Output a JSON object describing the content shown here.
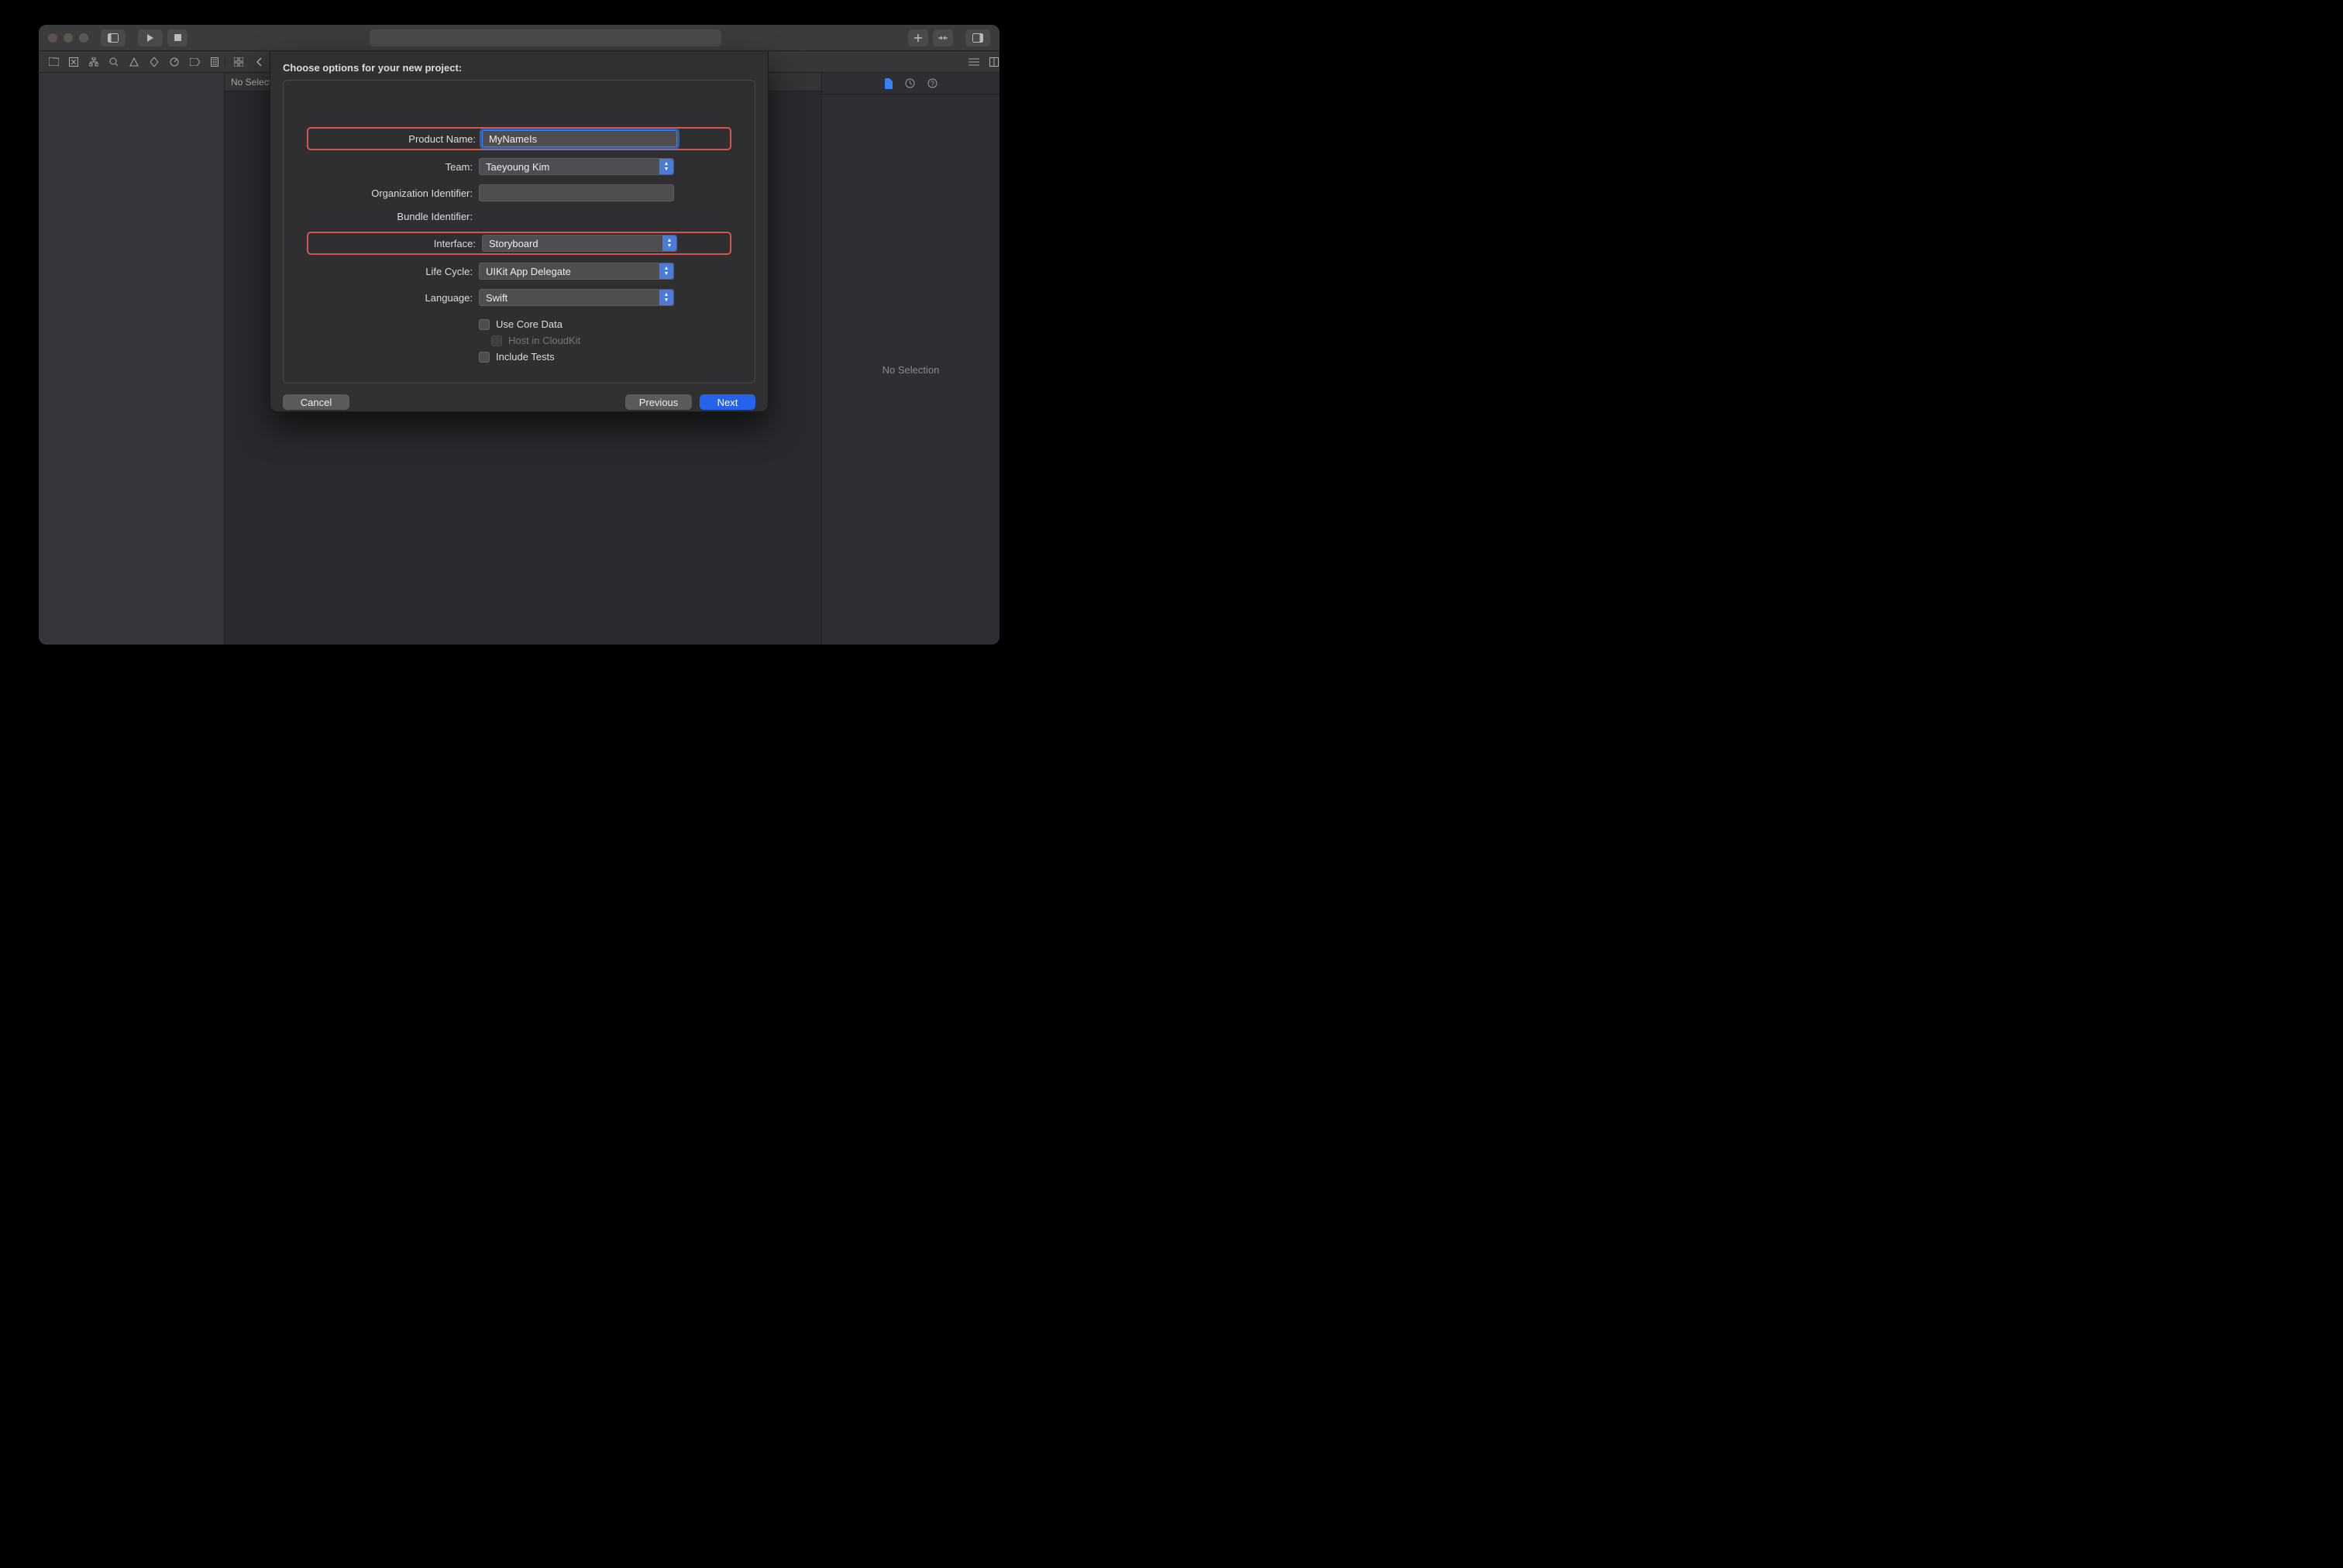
{
  "editor": {
    "header": "No Selection"
  },
  "inspector": {
    "empty_text": "No Selection"
  },
  "dialog": {
    "title": "Choose options for your new project:",
    "labels": {
      "product_name": "Product Name:",
      "team": "Team:",
      "org_id": "Organization Identifier:",
      "bundle_id": "Bundle Identifier:",
      "interface": "Interface:",
      "life_cycle": "Life Cycle:",
      "language": "Language:"
    },
    "values": {
      "product_name": "MyNameIs",
      "team": "Taeyoung Kim",
      "org_id": "",
      "bundle_id": "",
      "interface": "Storyboard",
      "life_cycle": "UIKit App Delegate",
      "language": "Swift"
    },
    "checks": {
      "use_core_data": "Use Core Data",
      "host_cloudkit": "Host in CloudKit",
      "include_tests": "Include Tests"
    },
    "buttons": {
      "cancel": "Cancel",
      "previous": "Previous",
      "next": "Next"
    }
  }
}
